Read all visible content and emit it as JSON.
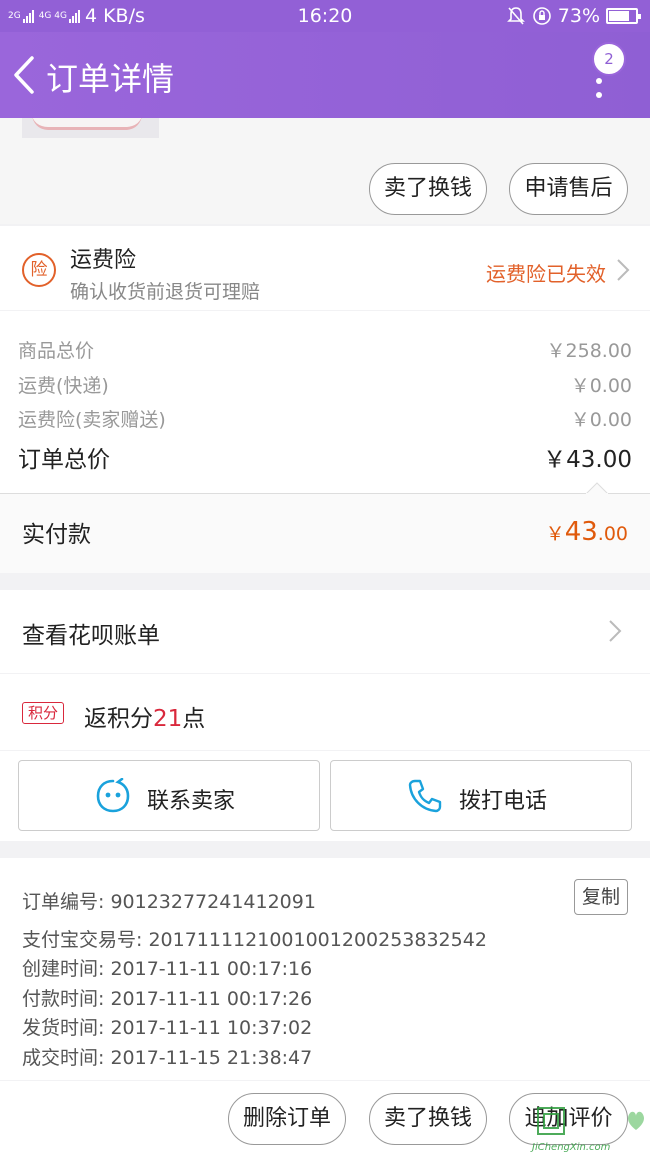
{
  "status_bar": {
    "network_left": "2G",
    "network_right": "4G 4G",
    "speed": "4 KB/s",
    "time": "16:20",
    "battery": "73%"
  },
  "header": {
    "title": "订单详情",
    "badge_count": "2"
  },
  "product": {
    "sell_button": "卖了换钱",
    "aftersale_button": "申请售后"
  },
  "insurance": {
    "icon_text": "险",
    "title": "运费险",
    "subtitle": "确认收货前退货可理赔",
    "status": "运费险已失效"
  },
  "prices": [
    {
      "label": "商品总价",
      "value": "￥258.00"
    },
    {
      "label": "运费(快递)",
      "value": "￥0.00"
    },
    {
      "label": "运费险(卖家赠送)",
      "value": "￥0.00"
    }
  ],
  "total": {
    "label": "订单总价",
    "value": "￥43.00"
  },
  "actual": {
    "label": "实付款",
    "currency": "￥",
    "integer": "43",
    "decimal": ".00"
  },
  "huabei": {
    "label": "查看花呗账单"
  },
  "points": {
    "tag": "积分",
    "prefix": "返积分",
    "count": "21",
    "suffix": "点"
  },
  "contact": {
    "seller_label": "联系卖家",
    "phone_label": "拨打电话"
  },
  "order_info": {
    "order_no": "订单编号: 90123277241412091",
    "copy_label": "复制",
    "alipay_no": "支付宝交易号: 2017111121001001200253832542",
    "created": "创建时间: 2017-11-11 00:17:16",
    "paid": "付款时间: 2017-11-11 00:17:26",
    "shipped": "发货时间: 2017-11-11 10:37:02",
    "completed": "成交时间: 2017-11-15 21:38:47"
  },
  "bottom_actions": {
    "delete": "删除订单",
    "sell": "卖了换钱",
    "review": "追加评价"
  },
  "watermark": {
    "text": "JiChengXin.com"
  },
  "colors": {
    "header_purple": "#9260d6",
    "accent_orange": "#e05a0c",
    "points_red": "#d9283c",
    "icon_blue": "#1aa2dc"
  }
}
